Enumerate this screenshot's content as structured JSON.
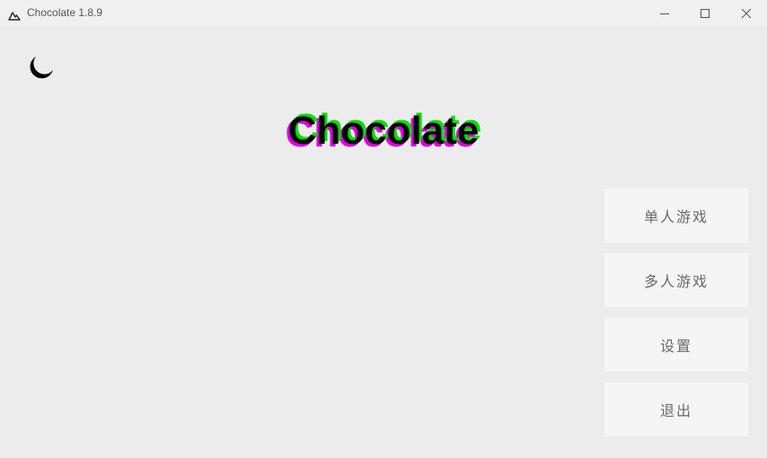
{
  "window": {
    "title": "Chocolate 1.8.9"
  },
  "logo": {
    "text": "Chocolate",
    "colors": {
      "front": "#000000",
      "shadow_left": "#e000e0",
      "shadow_right": "#00e000"
    }
  },
  "theme_toggle": {
    "icon": "moon-icon"
  },
  "menu": {
    "items": [
      {
        "label": "单人游戏"
      },
      {
        "label": "多人游戏"
      },
      {
        "label": "设置"
      },
      {
        "label": "退出"
      }
    ]
  }
}
